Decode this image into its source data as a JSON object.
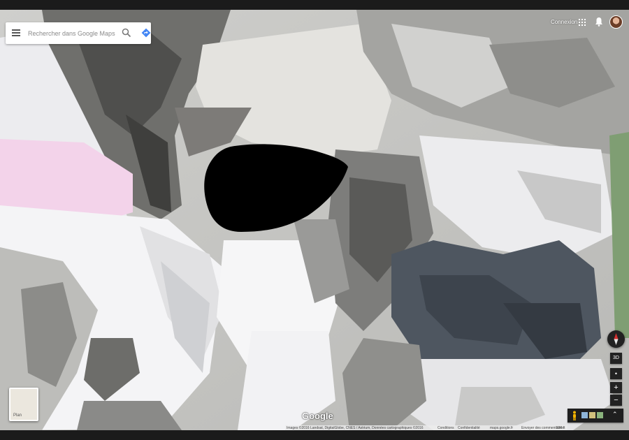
{
  "search": {
    "placeholder": "Rechercher dans Google Maps"
  },
  "header": {
    "signin_label": "Connexion"
  },
  "icons": {
    "menu": "menu-icon",
    "search": "search-icon",
    "directions": "directions-icon",
    "apps": "apps-grid-icon",
    "notifications": "notifications-icon",
    "avatar": "account-avatar",
    "pegman": "pegman-icon",
    "compass": "compass-icon",
    "expand": "expand-icon"
  },
  "layer_tile": {
    "label": "Plan"
  },
  "controls": {
    "three_d": "3D",
    "tilt": "•",
    "zoom_in": "+",
    "zoom_out": "−",
    "expand": "⌃"
  },
  "logo": {
    "text": "Google"
  },
  "footer": {
    "imagery": "Images ©2016 Landsat, DigitalGlobe, CNES / Astrium, Données cartographiques ©2016",
    "conditions": "Conditions",
    "privacy": "Confidentialité",
    "site": "maps.google.fr",
    "feedback": "Envoyer des commentaires",
    "scale": "500 ft"
  },
  "colors": {
    "accent_blue": "#4285f4",
    "compass_red": "#d32f2f",
    "redaction": "#000000"
  }
}
